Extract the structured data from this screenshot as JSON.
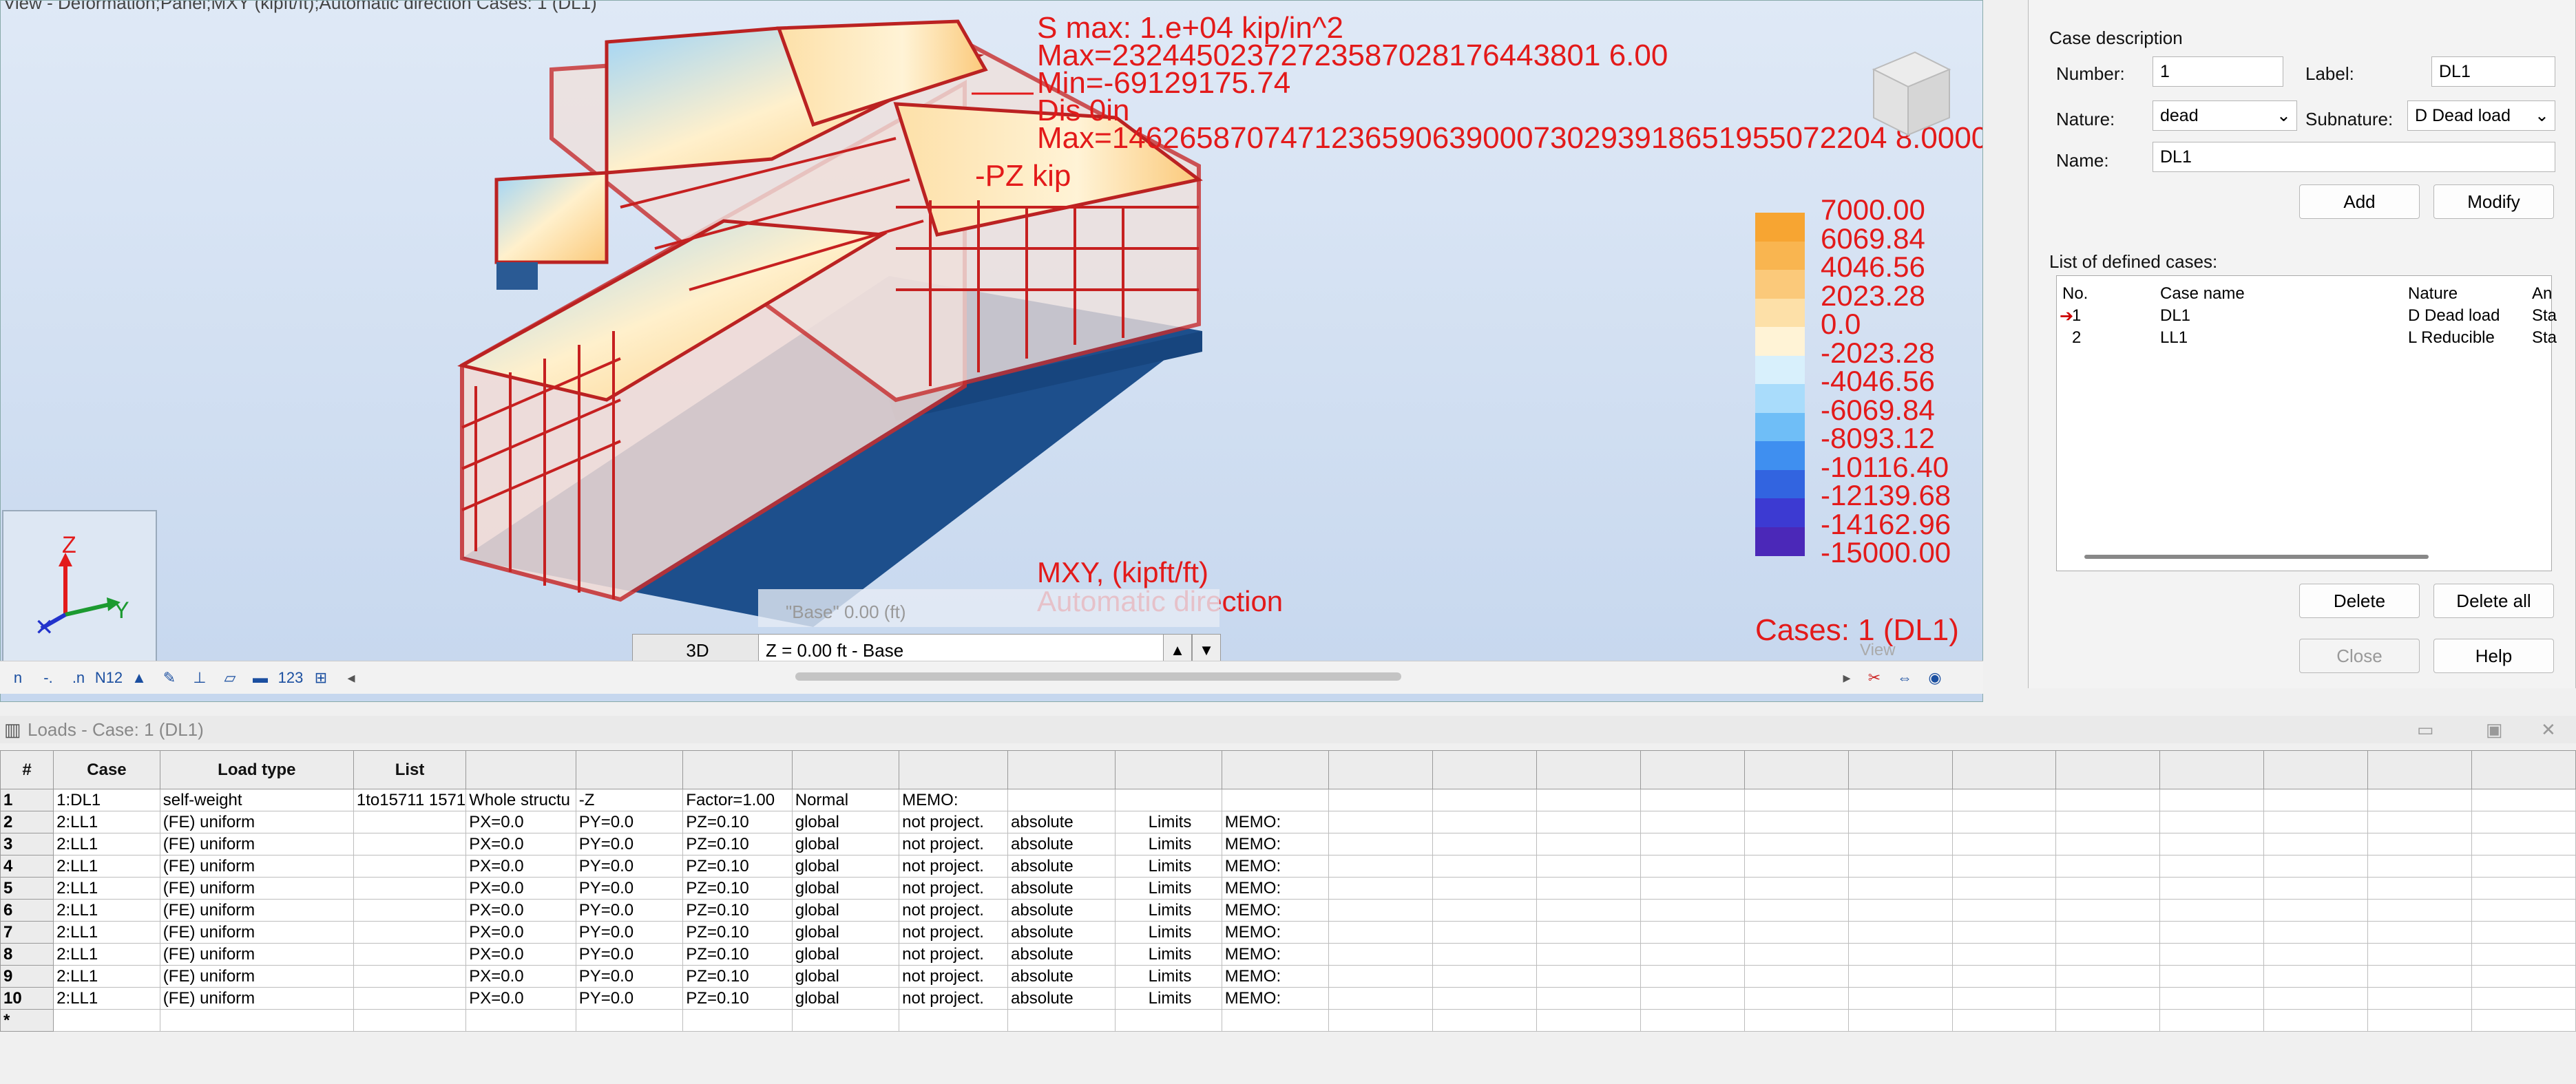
{
  "viewport": {
    "title_fragment": "View - Deformation;Panel;MXY (kipft/ft);Automatic direction Cases: 1 (DL1)",
    "result_lines": [
      "S max: 1.e+04 kip/in^2",
      "Max=23244502372723587028176443801 6.00",
      "Min=-69129175.74",
      "Dis  0in",
      "Max=1462658707471236590639000730293918651955072204 8.0000"
    ],
    "pz_label": "-PZ  kip",
    "legend": {
      "values": [
        "7000.00",
        "6069.84",
        "4046.56",
        "2023.28",
        "0.0",
        "-2023.28",
        "-4046.56",
        "-6069.84",
        "-8093.12",
        "-10116.40",
        "-12139.68",
        "-14162.96",
        "-15000.00"
      ],
      "colors": [
        "#f7a532",
        "#f9b550",
        "#fbc97a",
        "#fde0a8",
        "#fff3d6",
        "#d8f0fc",
        "#a9dcfb",
        "#6fbef7",
        "#3f8ff0",
        "#3264e0",
        "#3c3ad2",
        "#4b28b8",
        "#4b1a96"
      ]
    },
    "mxy_label": "MXY, (kipft/ft)",
    "direction_label": "Automatic direction",
    "cases_label": "Cases: 1 (DL1)",
    "base_label": "\"Base\"  0.00 (ft)",
    "tab_3d": "3D",
    "z_level": "Z = 0.00 ft - Base",
    "view_ghost": "View",
    "axis": {
      "z": "Z",
      "y": "Y"
    }
  },
  "side_panel": {
    "section_title": "Case description",
    "number_label": "Number:",
    "number_value": "1",
    "label_label": "Label:",
    "label_value": "DL1",
    "nature_label": "Nature:",
    "nature_value": "dead",
    "subnature_label": "Subnature:",
    "subnature_value": "D Dead load",
    "name_label": "Name:",
    "name_value": "DL1",
    "add_btn": "Add",
    "modify_btn": "Modify",
    "list_title": "List of defined cases:",
    "list_headers": [
      "No.",
      "Case name",
      "Nature",
      "An"
    ],
    "list_rows": [
      {
        "no": "1",
        "name": "DL1",
        "nature": "D Dead load",
        "an": "Sta"
      },
      {
        "no": "2",
        "name": "LL1",
        "nature": "L Reducible",
        "an": "Sta"
      }
    ],
    "delete_btn": "Delete",
    "delete_all_btn": "Delete all",
    "close_btn": "Close",
    "help_btn": "Help"
  },
  "loads": {
    "title": "Loads - Case: 1 (DL1)",
    "headers": [
      "#",
      "Case",
      "Load type",
      "List",
      "",
      "",
      "",
      "",
      "",
      "",
      "",
      ""
    ],
    "rows": [
      [
        "1",
        "1:DL1",
        "self-weight",
        "1to15711 1571",
        "Whole structu",
        "-Z",
        "Factor=1.00",
        "Normal",
        "MEMO:",
        "",
        "",
        ""
      ],
      [
        "2",
        "2:LL1",
        "(FE) uniform",
        "",
        "PX=0.0",
        "PY=0.0",
        "PZ=0.10",
        "global",
        "not project.",
        "absolute",
        "Limits",
        "MEMO:"
      ],
      [
        "3",
        "2:LL1",
        "(FE) uniform",
        "",
        "PX=0.0",
        "PY=0.0",
        "PZ=0.10",
        "global",
        "not project.",
        "absolute",
        "Limits",
        "MEMO:"
      ],
      [
        "4",
        "2:LL1",
        "(FE) uniform",
        "",
        "PX=0.0",
        "PY=0.0",
        "PZ=0.10",
        "global",
        "not project.",
        "absolute",
        "Limits",
        "MEMO:"
      ],
      [
        "5",
        "2:LL1",
        "(FE) uniform",
        "",
        "PX=0.0",
        "PY=0.0",
        "PZ=0.10",
        "global",
        "not project.",
        "absolute",
        "Limits",
        "MEMO:"
      ],
      [
        "6",
        "2:LL1",
        "(FE) uniform",
        "",
        "PX=0.0",
        "PY=0.0",
        "PZ=0.10",
        "global",
        "not project.",
        "absolute",
        "Limits",
        "MEMO:"
      ],
      [
        "7",
        "2:LL1",
        "(FE) uniform",
        "",
        "PX=0.0",
        "PY=0.0",
        "PZ=0.10",
        "global",
        "not project.",
        "absolute",
        "Limits",
        "MEMO:"
      ],
      [
        "8",
        "2:LL1",
        "(FE) uniform",
        "",
        "PX=0.0",
        "PY=0.0",
        "PZ=0.10",
        "global",
        "not project.",
        "absolute",
        "Limits",
        "MEMO:"
      ],
      [
        "9",
        "2:LL1",
        "(FE) uniform",
        "",
        "PX=0.0",
        "PY=0.0",
        "PZ=0.10",
        "global",
        "not project.",
        "absolute",
        "Limits",
        "MEMO:"
      ],
      [
        "10",
        "2:LL1",
        "(FE) uniform",
        "",
        "PX=0.0",
        "PY=0.0",
        "PZ=0.10",
        "global",
        "not project.",
        "absolute",
        "Limits",
        "MEMO:"
      ],
      [
        "*",
        "",
        "",
        "",
        "",
        "",
        "",
        "",
        "",
        "",
        "",
        ""
      ]
    ]
  }
}
